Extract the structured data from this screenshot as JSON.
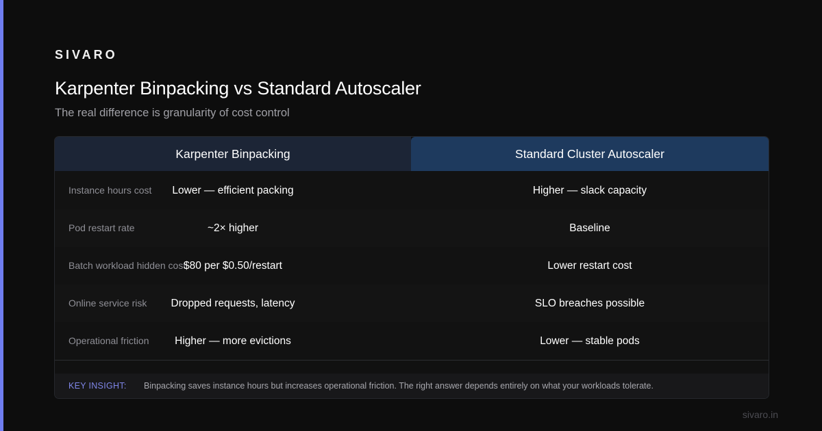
{
  "brand": "SIVARO",
  "title": "Karpenter Binpacking vs Standard Autoscaler",
  "subtitle": "The real difference is granularity of cost control",
  "columns": {
    "left": "Karpenter Binpacking",
    "right": "Standard Cluster Autoscaler"
  },
  "rows": [
    {
      "label": "Instance hours cost",
      "karpenter": "Lower — efficient packing",
      "standard": "Higher — slack capacity"
    },
    {
      "label": "Pod restart rate",
      "karpenter": "~2× higher",
      "standard": "Baseline"
    },
    {
      "label": "Batch workload hidden cost",
      "karpenter": "$80 per $0.50/restart",
      "standard": "Lower restart cost"
    },
    {
      "label": "Online service risk",
      "karpenter": "Dropped requests, latency",
      "standard": "SLO breaches possible"
    },
    {
      "label": "Operational friction",
      "karpenter": "Higher — more evictions",
      "standard": "Lower — stable pods"
    }
  ],
  "insight": {
    "key": "KEY INSIGHT:",
    "text": "Binpacking saves instance hours but increases operational friction. The right answer depends entirely on what your workloads tolerate."
  },
  "footer": "sivaro.in",
  "colors": {
    "background": "#0d0d0d",
    "accent": "#6f7df0",
    "header_left": "#1c2536",
    "header_right": "#1e3a5e",
    "insight_key": "#7f86e8"
  }
}
